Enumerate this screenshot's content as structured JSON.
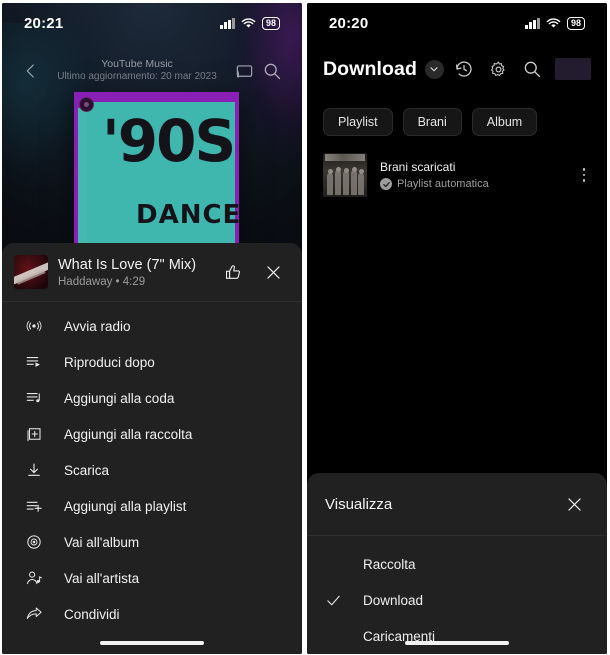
{
  "left": {
    "status": {
      "time": "20:21",
      "battery": "98"
    },
    "header": {
      "title": "YouTube Music",
      "subtitle": "Ultimo aggiornamento: 20 mar 2023",
      "back_icon": "chevron-left-icon",
      "cast_icon": "cast-icon",
      "search_icon": "search-icon"
    },
    "artwork": {
      "line1": "'90S",
      "line2": "DANCE"
    },
    "now_sheet": {
      "title": "What Is Love (7\" Mix)",
      "subtitle": "Haddaway • 4:29",
      "like_icon": "thumbs-up-icon",
      "close_icon": "close-icon"
    },
    "menu": [
      {
        "label": "Avvia radio",
        "icon": "radio-icon"
      },
      {
        "label": "Riproduci dopo",
        "icon": "play-next-icon"
      },
      {
        "label": "Aggiungi alla coda",
        "icon": "add-to-queue-icon"
      },
      {
        "label": "Aggiungi alla raccolta",
        "icon": "add-to-library-icon"
      },
      {
        "label": "Scarica",
        "icon": "download-icon"
      },
      {
        "label": "Aggiungi alla playlist",
        "icon": "add-to-playlist-icon"
      },
      {
        "label": "Vai all'album",
        "icon": "album-icon"
      },
      {
        "label": "Vai all'artista",
        "icon": "artist-icon"
      },
      {
        "label": "Condividi",
        "icon": "share-icon"
      }
    ]
  },
  "right": {
    "status": {
      "time": "20:20",
      "battery": "98"
    },
    "header": {
      "title": "Download",
      "chevron_icon": "chevron-down-icon",
      "history_icon": "history-icon",
      "settings_icon": "gear-icon",
      "search_icon": "search-icon",
      "avatar": "avatar"
    },
    "chips": [
      {
        "label": "Playlist"
      },
      {
        "label": "Brani"
      },
      {
        "label": "Album"
      }
    ],
    "playlist": {
      "title": "Brani scaricati",
      "subtitle": "Playlist automatica",
      "badge_icon": "check-circle-icon",
      "menu_icon": "kebab-menu-icon"
    },
    "view_sheet": {
      "title": "Visualizza",
      "close_icon": "close-icon",
      "options": [
        {
          "label": "Raccolta",
          "selected": false
        },
        {
          "label": "Download",
          "selected": true
        },
        {
          "label": "Caricamenti",
          "selected": false
        }
      ]
    }
  },
  "colors": {
    "sheet_bg": "#212121",
    "accent_purple": "#8a1fb5",
    "accent_teal": "#3fb6ae"
  }
}
